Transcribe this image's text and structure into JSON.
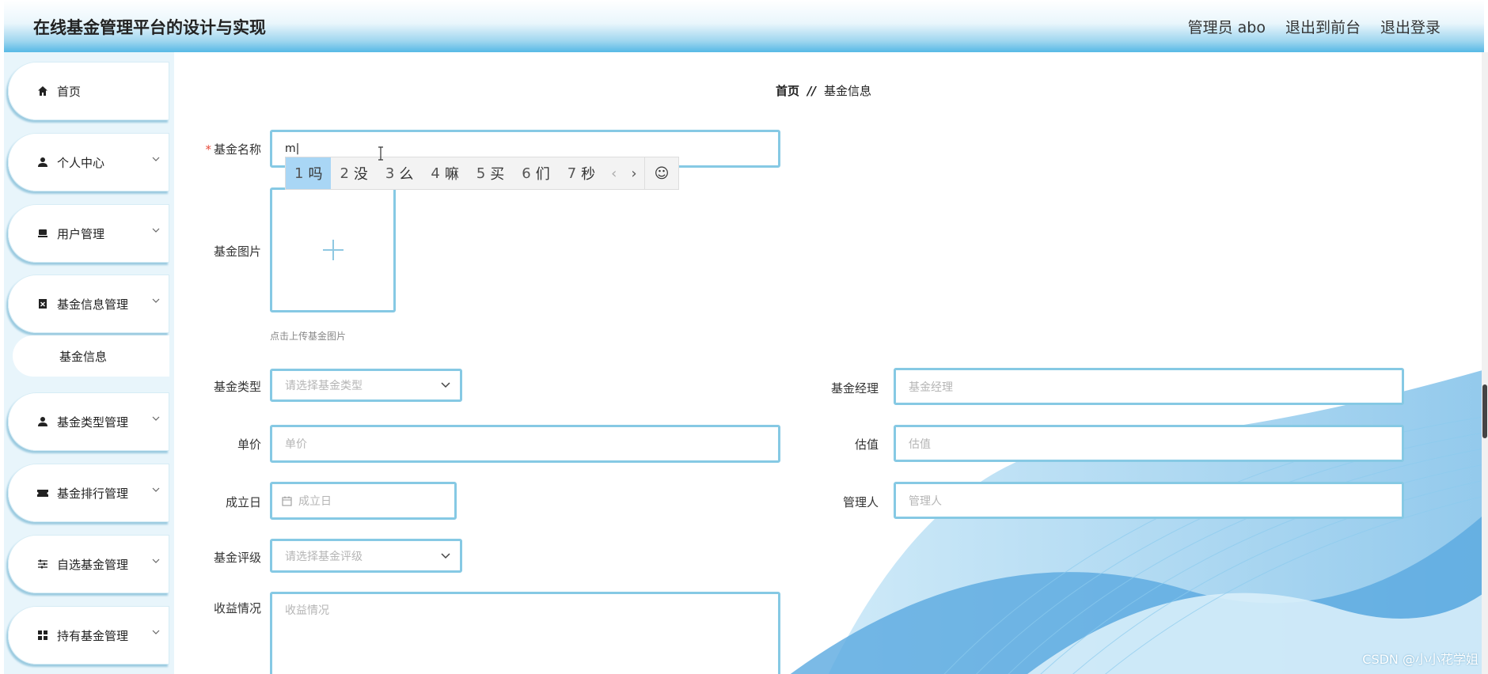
{
  "header": {
    "title": "在线基金管理平台的设计与实现",
    "user_label": "管理员 abo",
    "to_front": "退出到前台",
    "logout": "退出登录"
  },
  "sidebar": {
    "items": [
      {
        "label": "首页",
        "icon": "home-icon"
      },
      {
        "label": "个人中心",
        "icon": "user-icon"
      },
      {
        "label": "用户管理",
        "icon": "users-icon"
      },
      {
        "label": "基金信息管理",
        "icon": "clipboard-icon"
      },
      {
        "label": "基金类型管理",
        "icon": "user-icon"
      },
      {
        "label": "基金排行管理",
        "icon": "ticket-icon"
      },
      {
        "label": "自选基金管理",
        "icon": "sliders-icon"
      },
      {
        "label": "持有基金管理",
        "icon": "grid-icon"
      }
    ],
    "sub_item": "基金信息"
  },
  "breadcrumb": {
    "home": "首页",
    "sep": "//",
    "current": "基金信息"
  },
  "form": {
    "name": {
      "label": "基金名称",
      "value": "m"
    },
    "image": {
      "label": "基金图片",
      "hint": "点击上传基金图片"
    },
    "type": {
      "label": "基金类型",
      "placeholder": "请选择基金类型"
    },
    "manager": {
      "label": "基金经理",
      "placeholder": "基金经理"
    },
    "price": {
      "label": "单价",
      "placeholder": "单价"
    },
    "valuation": {
      "label": "估值",
      "placeholder": "估值"
    },
    "founded": {
      "label": "成立日",
      "placeholder": "成立日"
    },
    "admin": {
      "label": "管理人",
      "placeholder": "管理人"
    },
    "rating": {
      "label": "基金评级",
      "placeholder": "请选择基金评级"
    },
    "returns": {
      "label": "收益情况",
      "placeholder": "收益情况"
    }
  },
  "ime": {
    "candidates": [
      {
        "n": "1",
        "c": "吗"
      },
      {
        "n": "2",
        "c": "没"
      },
      {
        "n": "3",
        "c": "么"
      },
      {
        "n": "4",
        "c": "嘛"
      },
      {
        "n": "5",
        "c": "买"
      },
      {
        "n": "6",
        "c": "们"
      },
      {
        "n": "7",
        "c": "秒"
      }
    ],
    "emoji": "☺"
  },
  "watermark": "CSDN @小小花学姐",
  "colors": {
    "accent": "#86c9e4",
    "header_blue": "#5bbbe6",
    "sidebar_bg": "#e8f5fb",
    "required": "#e74c3c"
  }
}
